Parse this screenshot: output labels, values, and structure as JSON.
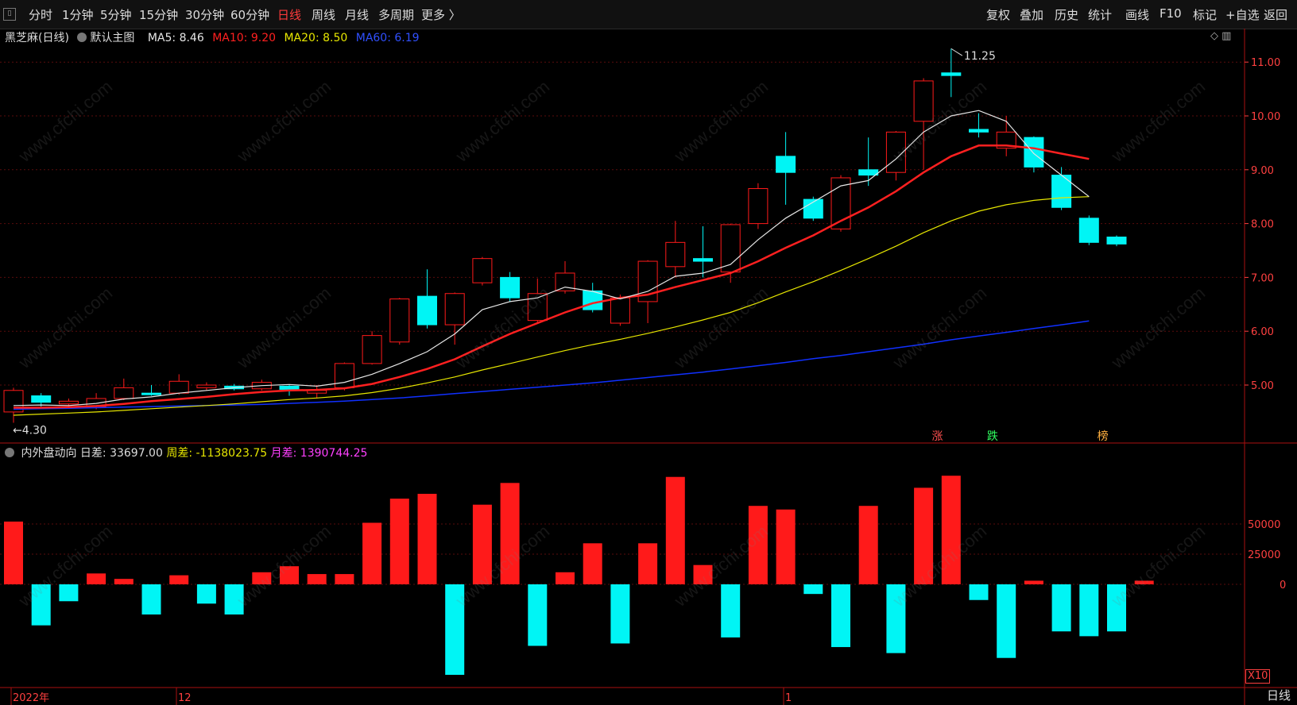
{
  "toolbar": {
    "left_items": [
      "分时",
      "1分钟",
      "5分钟",
      "15分钟",
      "30分钟",
      "60分钟",
      "日线",
      "周线",
      "月线",
      "多周期",
      "更多 〉"
    ],
    "active_item": "日线",
    "right_items": [
      "复权",
      "叠加",
      "历史",
      "统计",
      "画线",
      "F10",
      "标记",
      "+自选",
      "返回"
    ]
  },
  "main_info": {
    "stock_name": "黑芝麻(日线)",
    "template": "默认主图",
    "ma5": "MA5: 8.46",
    "ma10": "MA10: 9.20",
    "ma20": "MA20: 8.50",
    "ma60": "MA60: 6.19"
  },
  "indicator_info": {
    "name": "内外盘动向",
    "daily": "日差: 33697.00",
    "weekly": "周差: -1138023.75",
    "monthly": "月差: 1390744.25"
  },
  "colors": {
    "up": "#ff1a1a",
    "down": "#00f5f5",
    "ma5": "#e6e6e6",
    "ma10": "#ff2020",
    "ma20": "#e6e600",
    "ma60": "#1030ff",
    "axis": "#ff4040"
  },
  "price_axis": {
    "ticks": [
      "11.00",
      "10.00",
      "9.00",
      "8.00",
      "7.00",
      "6.00",
      "5.00"
    ],
    "values": [
      11,
      10,
      9,
      8,
      7,
      6,
      5
    ]
  },
  "price_annotations": {
    "high": "11.25",
    "low": "4.30"
  },
  "volume_axis": {
    "ticks": [
      "50000",
      "25000",
      "0"
    ],
    "values": [
      50000,
      25000,
      0
    ],
    "multiplier": "X10"
  },
  "date_labels": [
    "2022年",
    "12",
    "1"
  ],
  "period_label": "日线",
  "markers": [
    {
      "text": "涨",
      "color": "#ff5050"
    },
    {
      "text": "跌",
      "color": "#30ff60"
    },
    {
      "text": "榜",
      "color": "#ffb040"
    }
  ],
  "watermark": "www.cfchi.com",
  "chart_data": {
    "type": "candlestick",
    "candles": [
      {
        "o": 4.5,
        "c": 4.9,
        "h": 4.95,
        "l": 4.3
      },
      {
        "o": 4.8,
        "c": 4.68,
        "h": 4.85,
        "l": 4.6
      },
      {
        "o": 4.65,
        "c": 4.7,
        "h": 4.75,
        "l": 4.6
      },
      {
        "o": 4.6,
        "c": 4.75,
        "h": 4.85,
        "l": 4.55
      },
      {
        "o": 4.75,
        "c": 4.95,
        "h": 5.12,
        "l": 4.72
      },
      {
        "o": 4.85,
        "c": 4.83,
        "h": 5.0,
        "l": 4.8
      },
      {
        "o": 4.85,
        "c": 5.07,
        "h": 5.2,
        "l": 4.82
      },
      {
        "o": 4.95,
        "c": 5.0,
        "h": 5.05,
        "l": 4.9
      },
      {
        "o": 4.98,
        "c": 4.93,
        "h": 5.02,
        "l": 4.9
      },
      {
        "o": 4.93,
        "c": 5.05,
        "h": 5.1,
        "l": 4.9
      },
      {
        "o": 4.98,
        "c": 4.92,
        "h": 5.0,
        "l": 4.8
      },
      {
        "o": 4.85,
        "c": 4.9,
        "h": 5.0,
        "l": 4.75
      },
      {
        "o": 4.95,
        "c": 5.4,
        "h": 5.42,
        "l": 4.9
      },
      {
        "o": 5.4,
        "c": 5.92,
        "h": 6.0,
        "l": 5.38
      },
      {
        "o": 5.8,
        "c": 6.6,
        "h": 6.62,
        "l": 5.75
      },
      {
        "o": 6.65,
        "c": 6.12,
        "h": 7.15,
        "l": 6.05
      },
      {
        "o": 6.12,
        "c": 6.7,
        "h": 6.72,
        "l": 5.75
      },
      {
        "o": 6.9,
        "c": 7.35,
        "h": 7.38,
        "l": 6.85
      },
      {
        "o": 7.0,
        "c": 6.62,
        "h": 7.1,
        "l": 6.55
      },
      {
        "o": 6.2,
        "c": 6.7,
        "h": 6.98,
        "l": 6.15
      },
      {
        "o": 6.75,
        "c": 7.08,
        "h": 7.3,
        "l": 6.7
      },
      {
        "o": 6.75,
        "c": 6.4,
        "h": 6.9,
        "l": 6.35
      },
      {
        "o": 6.15,
        "c": 6.62,
        "h": 6.68,
        "l": 6.1
      },
      {
        "o": 6.55,
        "c": 7.3,
        "h": 7.32,
        "l": 6.15
      },
      {
        "o": 7.2,
        "c": 7.65,
        "h": 8.05,
        "l": 7.0
      },
      {
        "o": 7.35,
        "c": 7.3,
        "h": 7.95,
        "l": 7.0
      },
      {
        "o": 7.1,
        "c": 7.98,
        "h": 8.0,
        "l": 6.9
      },
      {
        "o": 8.0,
        "c": 8.65,
        "h": 8.75,
        "l": 7.9
      },
      {
        "o": 9.25,
        "c": 8.95,
        "h": 9.7,
        "l": 8.35
      },
      {
        "o": 8.45,
        "c": 8.1,
        "h": 8.5,
        "l": 8.05
      },
      {
        "o": 7.9,
        "c": 8.85,
        "h": 8.9,
        "l": 7.85
      },
      {
        "o": 9.0,
        "c": 8.9,
        "h": 9.6,
        "l": 8.7
      },
      {
        "o": 8.95,
        "c": 9.7,
        "h": 9.72,
        "l": 8.8
      },
      {
        "o": 9.9,
        "c": 10.65,
        "h": 10.7,
        "l": 9.0
      },
      {
        "o": 10.8,
        "c": 10.75,
        "h": 11.25,
        "l": 10.35
      },
      {
        "o": 9.75,
        "c": 9.7,
        "h": 10.05,
        "l": 9.6
      },
      {
        "o": 9.4,
        "c": 9.7,
        "h": 10.0,
        "l": 9.25
      },
      {
        "o": 9.6,
        "c": 9.05,
        "h": 9.62,
        "l": 8.95
      },
      {
        "o": 8.9,
        "c": 8.3,
        "h": 9.05,
        "l": 8.25
      },
      {
        "o": 8.1,
        "c": 7.65,
        "h": 8.15,
        "l": 7.6
      },
      {
        "o": 7.75,
        "c": 7.62,
        "h": 7.78,
        "l": 7.58
      }
    ],
    "volume_diff": [
      52000,
      -34000,
      -14000,
      9000,
      4500,
      -25000,
      7500,
      -16000,
      -25000,
      10000,
      15000,
      8500,
      8500,
      51000,
      71000,
      75000,
      -75000,
      66000,
      84000,
      -51000,
      10000,
      34000,
      -49000,
      34000,
      89000,
      16000,
      -44000,
      65000,
      62000,
      -8000,
      -52000,
      65000,
      -57000,
      80000,
      90000,
      -13000,
      -61000,
      3000,
      -39000,
      -43000,
      -39000,
      3000
    ],
    "ma5": [
      4.62,
      4.63,
      4.62,
      4.66,
      4.74,
      4.78,
      4.85,
      4.9,
      4.95,
      4.99,
      5.01,
      4.98,
      5.05,
      5.2,
      5.4,
      5.62,
      5.95,
      6.4,
      6.55,
      6.62,
      6.82,
      6.74,
      6.6,
      6.74,
      7.02,
      7.08,
      7.24,
      7.7,
      8.1,
      8.4,
      8.7,
      8.8,
      9.2,
      9.7,
      10.0,
      10.1,
      9.9,
      9.3,
      8.9,
      8.5
    ],
    "ma10": [
      4.58,
      4.58,
      4.59,
      4.61,
      4.65,
      4.7,
      4.74,
      4.78,
      4.83,
      4.87,
      4.9,
      4.91,
      4.94,
      5.02,
      5.15,
      5.3,
      5.48,
      5.72,
      5.95,
      6.15,
      6.35,
      6.52,
      6.62,
      6.68,
      6.82,
      6.95,
      7.08,
      7.3,
      7.55,
      7.78,
      8.05,
      8.3,
      8.6,
      8.95,
      9.25,
      9.45,
      9.45,
      9.4,
      9.3,
      9.2
    ],
    "ma20": [
      4.44,
      4.46,
      4.48,
      4.5,
      4.53,
      4.56,
      4.59,
      4.62,
      4.65,
      4.69,
      4.73,
      4.76,
      4.8,
      4.86,
      4.94,
      5.04,
      5.15,
      5.28,
      5.4,
      5.52,
      5.64,
      5.75,
      5.85,
      5.96,
      6.08,
      6.21,
      6.35,
      6.53,
      6.73,
      6.92,
      7.13,
      7.35,
      7.58,
      7.83,
      8.05,
      8.23,
      8.35,
      8.43,
      8.48,
      8.5
    ],
    "ma60": [
      4.55,
      4.56,
      4.57,
      4.58,
      4.59,
      4.6,
      4.61,
      4.62,
      4.63,
      4.64,
      4.66,
      4.68,
      4.7,
      4.73,
      4.76,
      4.8,
      4.84,
      4.88,
      4.92,
      4.96,
      5.0,
      5.04,
      5.09,
      5.14,
      5.19,
      5.24,
      5.3,
      5.36,
      5.42,
      5.49,
      5.55,
      5.62,
      5.69,
      5.76,
      5.84,
      5.91,
      5.98,
      6.05,
      6.12,
      6.19
    ]
  }
}
